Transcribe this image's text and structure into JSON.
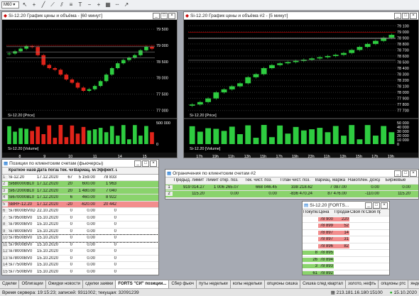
{
  "toolbar": {
    "combo": "M60",
    "icons": [
      "cursor-icon",
      "cross-icon",
      "line-icon",
      "diagonal-icon",
      "channel-icon",
      "fib-icon",
      "text-icon",
      "minus-icon",
      "plus-icon",
      "grid-icon",
      "dash-icon",
      "arrow-icon"
    ]
  },
  "chart1": {
    "title": "Si-12.20 График цены и объёма - [60 минут]",
    "price_label": "Si-12.20 [Price]",
    "volume_label": "Si-12.20 [Volume]",
    "y_ticks": [
      "79 500",
      "79 000",
      "78 500",
      "78 000",
      "77 500",
      "77 000"
    ],
    "v_ticks": [
      "500 000",
      "0"
    ],
    "x_ticks": [
      "8",
      "9",
      "10",
      "11",
      "14",
      "15"
    ],
    "price_tags": [
      "79 000",
      "78 960",
      "78 800",
      "78 622"
    ],
    "chart_data": {
      "type": "candlestick",
      "close": [
        78750,
        78820,
        78900,
        78980,
        78950,
        78700,
        78400,
        78300,
        78250,
        78100,
        77950,
        77850,
        77700,
        77600,
        77650,
        77750,
        77900,
        78100,
        78300,
        78450,
        78550,
        78620,
        78700,
        78850,
        78960,
        78900
      ],
      "ylim": [
        76900,
        79700
      ]
    }
  },
  "chart2": {
    "title": "Si-12.20 График цены и объёма #2 - [5 минут]",
    "price_label": "Si-12.20 [Price]",
    "volume_label": "Si-12.20 [Volume]",
    "y_ticks": [
      "79 100",
      "79 000",
      "78 900",
      "78 800",
      "78 700",
      "78 600",
      "78 500",
      "78 400",
      "78 300",
      "78 200",
      "78 100",
      "78 000",
      "77 900",
      "77 800",
      "77 700"
    ],
    "v_ticks": [
      "50 000",
      "40 000",
      "30 000",
      "20 000",
      "10 000",
      "0"
    ],
    "x_ticks": [
      "17h",
      "19h",
      "11h",
      "13h",
      "15h",
      "17h",
      "19h",
      "23h",
      "11h",
      "13h",
      "15h",
      "17h",
      "19h"
    ],
    "price_tags": [
      "78 990",
      "78 900",
      "78 888",
      "78 530"
    ],
    "chart_data": {
      "type": "candlestick",
      "close": [
        77800,
        77840,
        77900,
        78000,
        78050,
        78100,
        78150,
        78250,
        78300,
        78400,
        78450,
        78480,
        78500,
        78520,
        78540,
        78560,
        78580,
        78600,
        78620,
        78650,
        78700,
        78750,
        78800,
        78850,
        78900,
        78950
      ],
      "ylim": [
        77650,
        79150
      ]
    }
  },
  "positions": {
    "title": "Позиции по клиентским счетам (фьючерсы)",
    "headers": [
      "Краткое название",
      "Дата погаш.",
      "Тек. чист.",
      "Вариац. маржа",
      "Эффект. цен."
    ],
    "rows": [
      [
        "Si-12.20",
        "17.12.2020",
        "67",
        "5 159.00",
        "78 833"
      ],
      [
        "Si680000BL0",
        "17.12.2020",
        "20",
        "600.00",
        "1 963"
      ],
      [
        "Si672000BL0",
        "17.12.2020",
        "20",
        "1 480.00",
        "7 040"
      ],
      [
        "Si670000BL0",
        "17.12.2020",
        "6",
        "460.00",
        "8 922"
      ],
      [
        "SBRF-12.20",
        "17.12.2020",
        "-20",
        "-620.00",
        "20 442"
      ],
      [
        "Si78000BV0D",
        "22.10.2020",
        "0",
        "0.00",
        "0"
      ],
      [
        "Si79500BV0",
        "15.10.2020",
        "0",
        "0.00",
        "0"
      ],
      [
        "Si79000BV0",
        "15.10.2020",
        "0",
        "0.00",
        "0"
      ],
      [
        "Si78000BV0",
        "15.10.2020",
        "0",
        "0.00",
        "0"
      ],
      [
        "Si78500BV0",
        "15.10.2020",
        "0",
        "0.00",
        "0"
      ],
      [
        "Si79000BV0",
        "15.10.2020",
        "0",
        "0.00",
        "0"
      ],
      [
        "Si78000BV0",
        "15.10.2020",
        "0",
        "0.00",
        "0"
      ],
      [
        "Si78000BV0",
        "15.10.2020",
        "0",
        "0.00",
        "0"
      ],
      [
        "Si77500BV0",
        "15.10.2020",
        "0",
        "0.00",
        "0"
      ],
      [
        "Si77500BV0",
        "15.10.2020",
        "0",
        "0.00",
        "0"
      ],
      [
        "Si77500BV0",
        "15.10.2020",
        "0",
        "0.00",
        "0"
      ],
      [
        "Si75000BV0",
        "15.10.2020",
        "0",
        "0.00",
        "0"
      ],
      [
        "Si73000BV0",
        "15.10.2020",
        "0",
        "0.00",
        "0"
      ]
    ],
    "row_nums": [
      "1",
      "2",
      "3",
      "4",
      "5",
      "6",
      "7",
      "8",
      "9",
      "10",
      "11",
      "12",
      "13",
      "14",
      "15",
      "16",
      "17",
      "18"
    ]
  },
  "limits": {
    "title": "Ограничения по клиентским счетам #2",
    "headers": [
      "Предыд. лимит",
      "Лимит откр. поз.",
      "Тек. чист. поз.",
      "План чист. поз.",
      "Вариац. маржа",
      "Накоплен. доход",
      "Биржевые"
    ],
    "rows": [
      [
        "1",
        "919 014.27",
        "1 006 265.07",
        "668 046.45",
        "338 218.62",
        "7 087.00",
        "0.00",
        "0.00"
      ],
      [
        "2",
        "115.20",
        "0.00",
        "0.00",
        "-836 470.24",
        "87 476.00",
        "-110.00",
        "115.20"
      ]
    ]
  },
  "dom": {
    "title": "Si-12.20 [FORTS...",
    "headers": [
      "Покупка",
      "Цена",
      "Продажа",
      "Своя пок.",
      "Своя пр."
    ],
    "asks": [
      [
        "78 900",
        "220"
      ],
      [
        "78 899",
        "52"
      ],
      [
        "78 897",
        "14"
      ],
      [
        "78 897",
        "31"
      ],
      [
        "78 896",
        "82"
      ]
    ],
    "bids": [
      [
        "8",
        "78 895"
      ],
      [
        "26",
        "78 894"
      ],
      [
        "3",
        "78 893"
      ],
      [
        "61",
        "78 892"
      ]
    ]
  },
  "tabs": [
    "Сделки",
    "Облигации",
    "Ожидки новости",
    "сделки заявки",
    "FORTS \"СИ\" позиции...",
    "Сбер фьюч",
    "путы недельки",
    "колы недельки",
    "опционы сишка",
    "Сишка след квартал",
    "золото, нефть",
    "опционы ртс",
    "яндекс"
  ],
  "status": {
    "time": "Время сервера: 19:15:23; записей: 9311002; текущая: 32091239",
    "ip": "213.181.16.180:15100",
    "date": "15.10.2020"
  },
  "colors": {
    "bull": "#2ecc40",
    "bear": "#e0241a",
    "highlight_green": "#8ad36c",
    "highlight_red": "#f28d8d"
  }
}
